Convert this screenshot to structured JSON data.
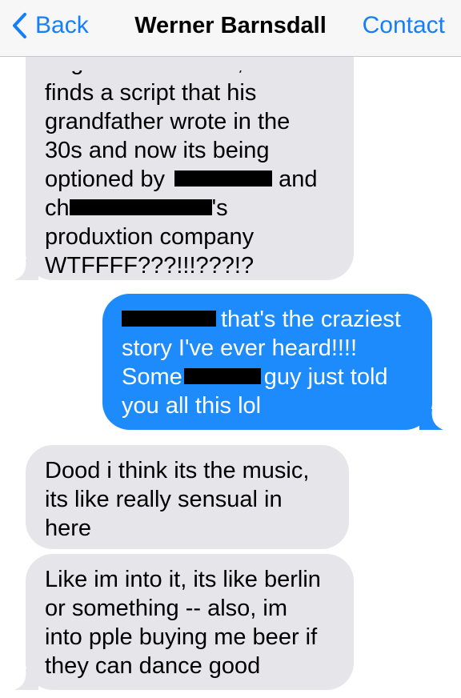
{
  "header": {
    "back_label": "Back",
    "title": "Werner Barnsdall",
    "contact_label": "Contact"
  },
  "messages": [
    {
      "direction": "incoming",
      "lines": [
        "dogs underneath it, and he",
        "finds a script that his",
        "grandfather wrote in the",
        "30s and now its being",
        "optioned by",
        "and",
        "ch",
        "'s",
        "produxtion company",
        "WTFFFF???!!!???!?"
      ]
    },
    {
      "direction": "outgoing",
      "lines": [
        "that's the craziest",
        "story I've ever heard!!!!",
        "Some",
        "guy just told",
        "you all this lol"
      ]
    },
    {
      "direction": "incoming",
      "lines": [
        "Dood i think its the music,",
        "its like really sensual in",
        "here"
      ]
    },
    {
      "direction": "incoming",
      "lines": [
        "Like im into it, its like berlin",
        "or something -- also, im",
        "into pple buying me beer if",
        "they can dance good"
      ]
    }
  ],
  "colors": {
    "accent": "#147efb",
    "outgoing_bubble": "#1d8bfb",
    "incoming_bubble": "#e5e5ea",
    "redaction": "#000000"
  }
}
